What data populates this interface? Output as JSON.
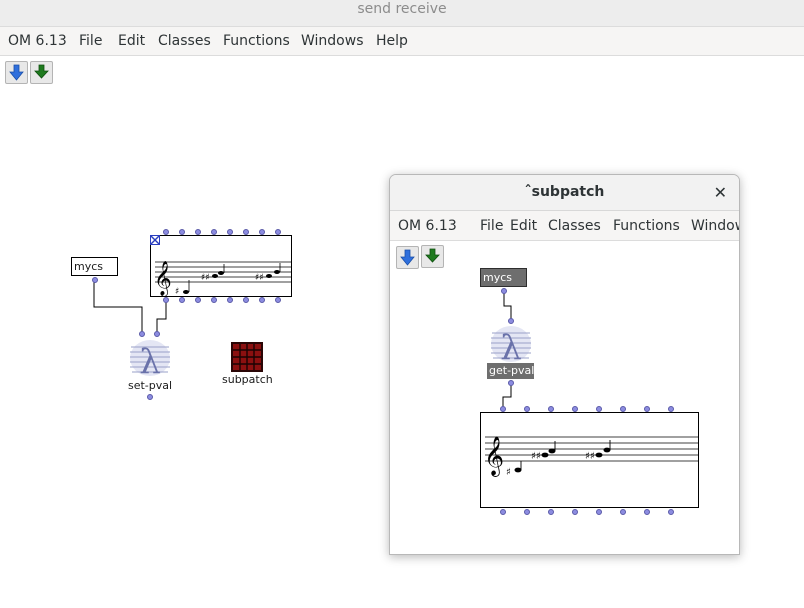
{
  "window": {
    "title": "send receive"
  },
  "menubar": {
    "items": [
      "OM 6.13",
      "File",
      "Edit",
      "Classes",
      "Functions",
      "Windows",
      "Help"
    ]
  },
  "patch": {
    "mycs_label": "mycs",
    "setpval_label": "set-pval",
    "subpatch_label": "subpatch"
  },
  "subwindow": {
    "title": "ˆsubpatch",
    "close_glyph": "✕",
    "menubar": {
      "items": [
        "OM 6.13",
        "File",
        "Edit",
        "Classes",
        "Functions",
        "Window"
      ]
    },
    "mycs_label": "mycs",
    "getpval_label": "get-pval"
  },
  "colors": {
    "down_arrow": "#2f6fdc",
    "green_arrow": "#1e7a1e",
    "inlet": "#8c8ce0",
    "subpatch_box": "#8b1010"
  }
}
